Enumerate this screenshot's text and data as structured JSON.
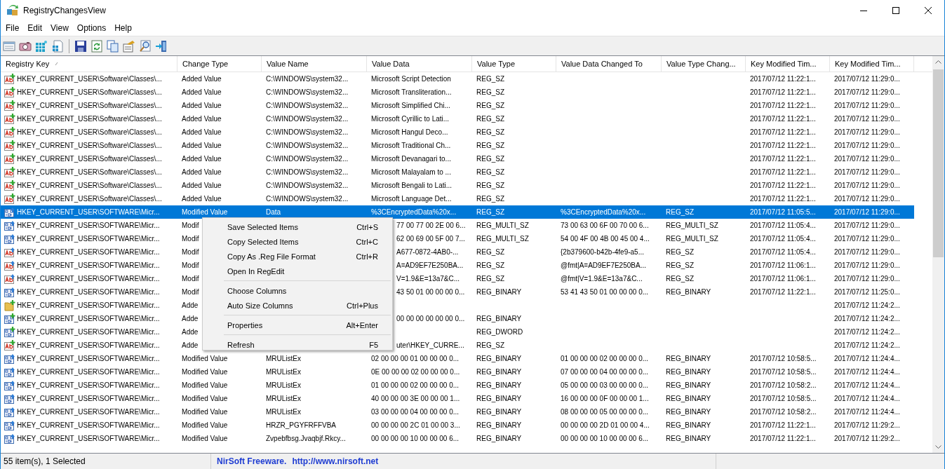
{
  "window": {
    "title": "RegistryChangesView"
  },
  "menu": [
    "File",
    "Edit",
    "View",
    "Options",
    "Help"
  ],
  "table": {
    "columns": [
      {
        "label": "Registry Key",
        "sorted": true
      },
      {
        "label": "Change Type",
        "sorted": false
      },
      {
        "label": "Value Name",
        "sorted": false
      },
      {
        "label": "Value Data",
        "sorted": false
      },
      {
        "label": "Value Type",
        "sorted": false
      },
      {
        "label": "Value Data Changed To",
        "sorted": false
      },
      {
        "label": "Value Type Chang...",
        "sorted": false
      },
      {
        "label": "Key Modified Tim...",
        "sorted": false
      },
      {
        "label": "Key Modified Tim...",
        "sorted": false
      }
    ],
    "rows": [
      {
        "kind": "string",
        "added": true,
        "selected": false,
        "cells": [
          "HKEY_CURRENT_USER\\Software\\Classes\\...",
          "Added Value",
          "C:\\WINDOWS\\system32...",
          "Microsoft Script Detection",
          "REG_SZ",
          null,
          null,
          "2017/07/12 11:22:1...",
          "2017/07/12 11:29:0..."
        ]
      },
      {
        "kind": "string",
        "added": true,
        "selected": false,
        "cells": [
          "HKEY_CURRENT_USER\\Software\\Classes\\...",
          "Added Value",
          "C:\\WINDOWS\\system32...",
          "Microsoft Transliteration...",
          "REG_SZ",
          null,
          null,
          "2017/07/12 11:22:1...",
          "2017/07/12 11:29:0..."
        ]
      },
      {
        "kind": "string",
        "added": true,
        "selected": false,
        "cells": [
          "HKEY_CURRENT_USER\\Software\\Classes\\...",
          "Added Value",
          "C:\\WINDOWS\\system32...",
          "Microsoft Simplified Chi...",
          "REG_SZ",
          null,
          null,
          "2017/07/12 11:22:1...",
          "2017/07/12 11:29:0..."
        ]
      },
      {
        "kind": "string",
        "added": true,
        "selected": false,
        "cells": [
          "HKEY_CURRENT_USER\\Software\\Classes\\...",
          "Added Value",
          "C:\\WINDOWS\\system32...",
          "Microsoft Cyrillic to Lati...",
          "REG_SZ",
          null,
          null,
          "2017/07/12 11:22:1...",
          "2017/07/12 11:29:0..."
        ]
      },
      {
        "kind": "string",
        "added": true,
        "selected": false,
        "cells": [
          "HKEY_CURRENT_USER\\Software\\Classes\\...",
          "Added Value",
          "C:\\WINDOWS\\system32...",
          "Microsoft Hangul Deco...",
          "REG_SZ",
          null,
          null,
          "2017/07/12 11:22:1...",
          "2017/07/12 11:29:0..."
        ]
      },
      {
        "kind": "string",
        "added": true,
        "selected": false,
        "cells": [
          "HKEY_CURRENT_USER\\Software\\Classes\\...",
          "Added Value",
          "C:\\WINDOWS\\system32...",
          "Microsoft Traditional Ch...",
          "REG_SZ",
          null,
          null,
          "2017/07/12 11:22:1...",
          "2017/07/12 11:29:0..."
        ]
      },
      {
        "kind": "string",
        "added": true,
        "selected": false,
        "cells": [
          "HKEY_CURRENT_USER\\Software\\Classes\\...",
          "Added Value",
          "C:\\WINDOWS\\system32...",
          "Microsoft Devanagari to...",
          "REG_SZ",
          null,
          null,
          "2017/07/12 11:22:1...",
          "2017/07/12 11:29:0..."
        ]
      },
      {
        "kind": "string",
        "added": true,
        "selected": false,
        "cells": [
          "HKEY_CURRENT_USER\\Software\\Classes\\...",
          "Added Value",
          "C:\\WINDOWS\\system32...",
          "Microsoft Malayalam to ...",
          "REG_SZ",
          null,
          null,
          "2017/07/12 11:22:1...",
          "2017/07/12 11:29:0..."
        ]
      },
      {
        "kind": "string",
        "added": true,
        "selected": false,
        "cells": [
          "HKEY_CURRENT_USER\\Software\\Classes\\...",
          "Added Value",
          "C:\\WINDOWS\\system32...",
          "Microsoft Bengali to Lati...",
          "REG_SZ",
          null,
          null,
          "2017/07/12 11:22:1...",
          "2017/07/12 11:29:0..."
        ]
      },
      {
        "kind": "string",
        "added": true,
        "selected": false,
        "cells": [
          "HKEY_CURRENT_USER\\Software\\Classes\\...",
          "Added Value",
          "C:\\WINDOWS\\system32...",
          "Microsoft Language Det...",
          "REG_SZ",
          null,
          null,
          "2017/07/12 11:22:1...",
          "2017/07/12 11:29:0..."
        ]
      },
      {
        "kind": "binary",
        "added": false,
        "selected": true,
        "cells": [
          "HKEY_CURRENT_USER\\SOFTWARE\\Micr...",
          "Modified Value",
          "Data",
          "%3CEncryptedData%20x...",
          "REG_SZ",
          "%3CEncryptedData%20x...",
          "REG_SZ",
          "2017/07/12 11:05:5...",
          "2017/07/12 11:29:0..."
        ]
      },
      {
        "kind": "binary",
        "added": false,
        "selected": false,
        "cells": [
          "HKEY_CURRENT_USER\\SOFTWARE\\Micr...",
          "Modif",
          null,
          "77 00 77 00 2E 00 6...",
          "REG_MULTI_SZ",
          "73 00 63 00 6F 00 70 00 6...",
          "REG_MULTI_SZ",
          "2017/07/12 11:05:4...",
          "2017/07/12 11:29:0..."
        ]
      },
      {
        "kind": "binary",
        "added": false,
        "selected": false,
        "cells": [
          "HKEY_CURRENT_USER\\SOFTWARE\\Micr...",
          "Modif",
          null,
          "62 00 69 00 5F 00 7...",
          "REG_MULTI_SZ",
          "54 00 4F 00 4B 00 45 00 4...",
          "REG_MULTI_SZ",
          "2017/07/12 11:05:4...",
          "2017/07/12 11:29:0..."
        ]
      },
      {
        "kind": "string",
        "added": false,
        "selected": false,
        "cells": [
          "HKEY_CURRENT_USER\\SOFTWARE\\Micr...",
          "Modif",
          null,
          "A677-0872-4AB0-...",
          "REG_SZ",
          "{2b379600-b42b-4fe9-a5...",
          "REG_SZ",
          "2017/07/12 11:05:4...",
          "2017/07/12 11:29:0..."
        ]
      },
      {
        "kind": "string",
        "added": false,
        "selected": false,
        "cells": [
          "HKEY_CURRENT_USER\\SOFTWARE\\Micr...",
          "Modif",
          null,
          "A=AD9EF7E250BA...",
          "REG_SZ",
          "@fmt|A=AD9EF7E250BA...",
          "REG_SZ",
          "2017/07/12 11:06:1...",
          "2017/07/12 11:29:0..."
        ]
      },
      {
        "kind": "string",
        "added": false,
        "selected": false,
        "cells": [
          "HKEY_CURRENT_USER\\SOFTWARE\\Micr...",
          "Modif",
          null,
          "V=1.9&E=13a7&C...",
          "REG_SZ",
          "@fmt|V=1.9&E=13a7&C...",
          "REG_SZ",
          "2017/07/12 11:06:1...",
          "2017/07/12 11:29:0..."
        ]
      },
      {
        "kind": "binary",
        "added": false,
        "selected": false,
        "cells": [
          "HKEY_CURRENT_USER\\SOFTWARE\\Micr...",
          "Modif",
          null,
          "43 50 01 00 00 00 0...",
          "REG_BINARY",
          "53 41 43 50 01 00 00 00 0...",
          "REG_BINARY",
          "2017/07/12 11:22:1...",
          "2017/07/12 11:25:0..."
        ]
      },
      {
        "kind": "key",
        "added": true,
        "selected": false,
        "cells": [
          "HKEY_CURRENT_USER\\SOFTWARE\\Micr...",
          "Adde",
          null,
          null,
          null,
          null,
          null,
          null,
          "2017/07/12 11:24:2..."
        ]
      },
      {
        "kind": "binary",
        "added": true,
        "selected": false,
        "cells": [
          "HKEY_CURRENT_USER\\SOFTWARE\\Micr...",
          "Adde",
          null,
          "00 00 00 00 00 00 0...",
          "REG_BINARY",
          null,
          null,
          null,
          "2017/07/12 11:24:2..."
        ]
      },
      {
        "kind": "binary",
        "added": true,
        "selected": false,
        "cells": [
          "HKEY_CURRENT_USER\\SOFTWARE\\Micr...",
          "Adde",
          null,
          null,
          "REG_DWORD",
          null,
          null,
          null,
          "2017/07/12 11:24:2..."
        ]
      },
      {
        "kind": "string",
        "added": true,
        "selected": false,
        "cells": [
          "HKEY_CURRENT_USER\\SOFTWARE\\Micr...",
          "Adde",
          null,
          "uter\\HKEY_CURRE...",
          "REG_SZ",
          null,
          null,
          null,
          "2017/07/12 11:24:2..."
        ]
      },
      {
        "kind": "binary",
        "added": false,
        "selected": false,
        "cells": [
          "HKEY_CURRENT_USER\\SOFTWARE\\Micr...",
          "Modified Value",
          "MRUListEx",
          "02 00 00 00 01 00 00 00 0...",
          "REG_BINARY",
          "01 00 00 00 02 00 00 00 0...",
          "REG_BINARY",
          "2017/07/12 10:58:5...",
          "2017/07/12 11:24:4..."
        ]
      },
      {
        "kind": "binary",
        "added": false,
        "selected": false,
        "cells": [
          "HKEY_CURRENT_USER\\SOFTWARE\\Micr...",
          "Modified Value",
          "MRUListEx",
          "0E 00 00 00 02 00 00 00 0...",
          "REG_BINARY",
          "07 00 00 00 04 00 00 00 0...",
          "REG_BINARY",
          "2017/07/12 10:58:5...",
          "2017/07/12 11:24:4..."
        ]
      },
      {
        "kind": "binary",
        "added": false,
        "selected": false,
        "cells": [
          "HKEY_CURRENT_USER\\SOFTWARE\\Micr...",
          "Modified Value",
          "MRUListEx",
          "01 00 00 00 02 00 00 00 0...",
          "REG_BINARY",
          "05 00 00 00 03 00 00 00 0...",
          "REG_BINARY",
          "2017/07/12 10:58:2...",
          "2017/07/12 11:24:4..."
        ]
      },
      {
        "kind": "binary",
        "added": false,
        "selected": false,
        "cells": [
          "HKEY_CURRENT_USER\\SOFTWARE\\Micr...",
          "Modified Value",
          "MRUListEx",
          "40 00 00 00 3E 00 00 00 1...",
          "REG_BINARY",
          "16 00 00 00 0F 00 00 00 1...",
          "REG_BINARY",
          "2017/07/12 10:58:5...",
          "2017/07/12 11:24:4..."
        ]
      },
      {
        "kind": "binary",
        "added": false,
        "selected": false,
        "cells": [
          "HKEY_CURRENT_USER\\SOFTWARE\\Micr...",
          "Modified Value",
          "MRUListEx",
          "03 00 00 00 04 00 00 00 0...",
          "REG_BINARY",
          "08 00 00 00 05 00 00 00 0...",
          "REG_BINARY",
          "2017/07/12 10:58:2...",
          "2017/07/12 11:24:4..."
        ]
      },
      {
        "kind": "binary",
        "added": false,
        "selected": false,
        "cells": [
          "HKEY_CURRENT_USER\\SOFTWARE\\Micr...",
          "Modified Value",
          "HRZR_PGYFRFFVBA",
          "00 00 00 00 2C 01 00 00 3...",
          "REG_BINARY",
          "00 00 00 00 2D 01 00 00 4...",
          "REG_BINARY",
          "2017/07/12 11:22:1...",
          "2017/07/12 11:29:2..."
        ]
      },
      {
        "kind": "binary",
        "added": false,
        "selected": false,
        "cells": [
          "HKEY_CURRENT_USER\\SOFTWARE\\Micr...",
          "Modified Value",
          "Zvpebfbsg.Jvaqbjf.Rkcy...",
          "00 00 00 00 10 00 00 00 6...",
          "REG_BINARY",
          "00 00 00 00 10 00 00 00 6...",
          "REG_BINARY",
          "2017/07/12 11:22:1...",
          "2017/07/12 11:29:2..."
        ]
      }
    ]
  },
  "context_menu": {
    "groups": [
      [
        {
          "label": "Save Selected Items",
          "shortcut": "Ctrl+S"
        },
        {
          "label": "Copy Selected Items",
          "shortcut": "Ctrl+C"
        },
        {
          "label": "Copy As .Reg File Format",
          "shortcut": "Ctrl+R"
        },
        {
          "label": "Open In RegEdit"
        }
      ],
      [
        {
          "label": "Choose Columns"
        },
        {
          "label": "Auto Size Columns",
          "shortcut": "Ctrl+Plus"
        }
      ],
      [
        {
          "label": "Properties",
          "shortcut": "Alt+Enter"
        }
      ],
      [
        {
          "label": "Refresh",
          "shortcut": "F5"
        }
      ]
    ]
  },
  "status_bar": {
    "count": "55 item(s), 1 Selected",
    "credit": "NirSoft Freeware.",
    "link": "http://www.nirsoft.net"
  }
}
